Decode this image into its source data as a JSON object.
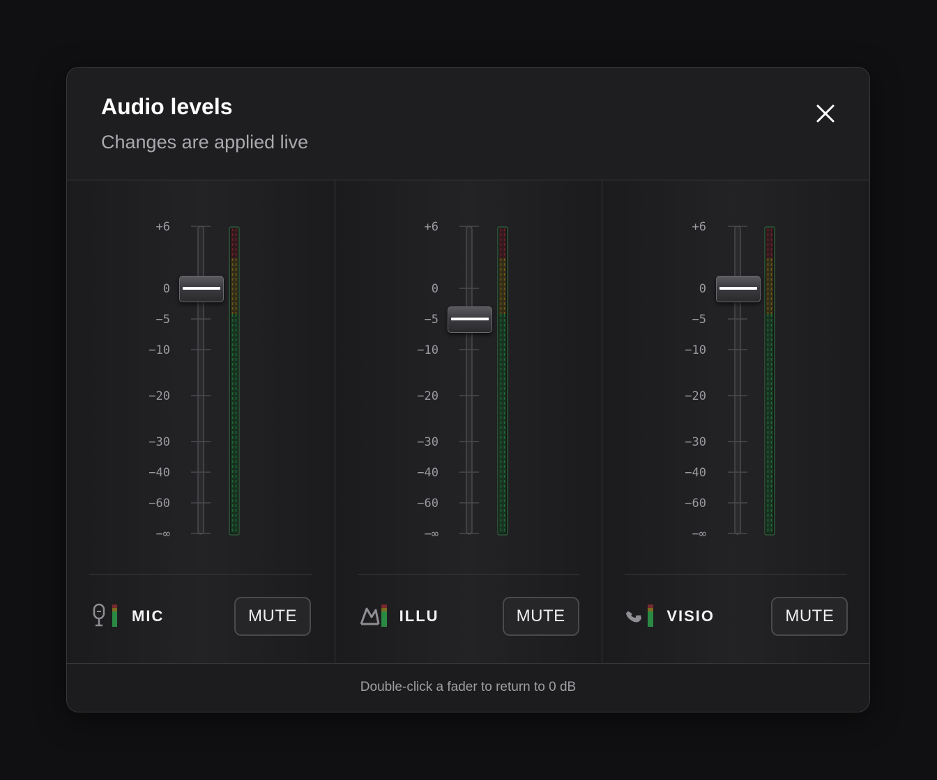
{
  "dialog": {
    "title": "Audio levels",
    "subtitle": "Changes are applied live",
    "close_icon": "close-icon",
    "footer_hint": "Double-click a fader to return to 0 dB"
  },
  "scale": [
    "+6",
    "0",
    "-5",
    "-10",
    "-20",
    "-30",
    "-40",
    "-60",
    "-∞"
  ],
  "channels": [
    {
      "label": "MIC",
      "icon": "microphone-icon",
      "fader_db": 0,
      "mute_label": "MUTE"
    },
    {
      "label": "ILLU",
      "icon": "mountain-icon",
      "fader_db": -5,
      "mute_label": "MUTE"
    },
    {
      "label": "VISIO",
      "icon": "phone-icon",
      "fader_db": 0,
      "mute_label": "MUTE"
    }
  ],
  "colors": {
    "meter_green": "#1f6b35",
    "meter_yellow": "#6b5a1a",
    "meter_red": "#6b2228",
    "knob_line": "#ffffff"
  }
}
